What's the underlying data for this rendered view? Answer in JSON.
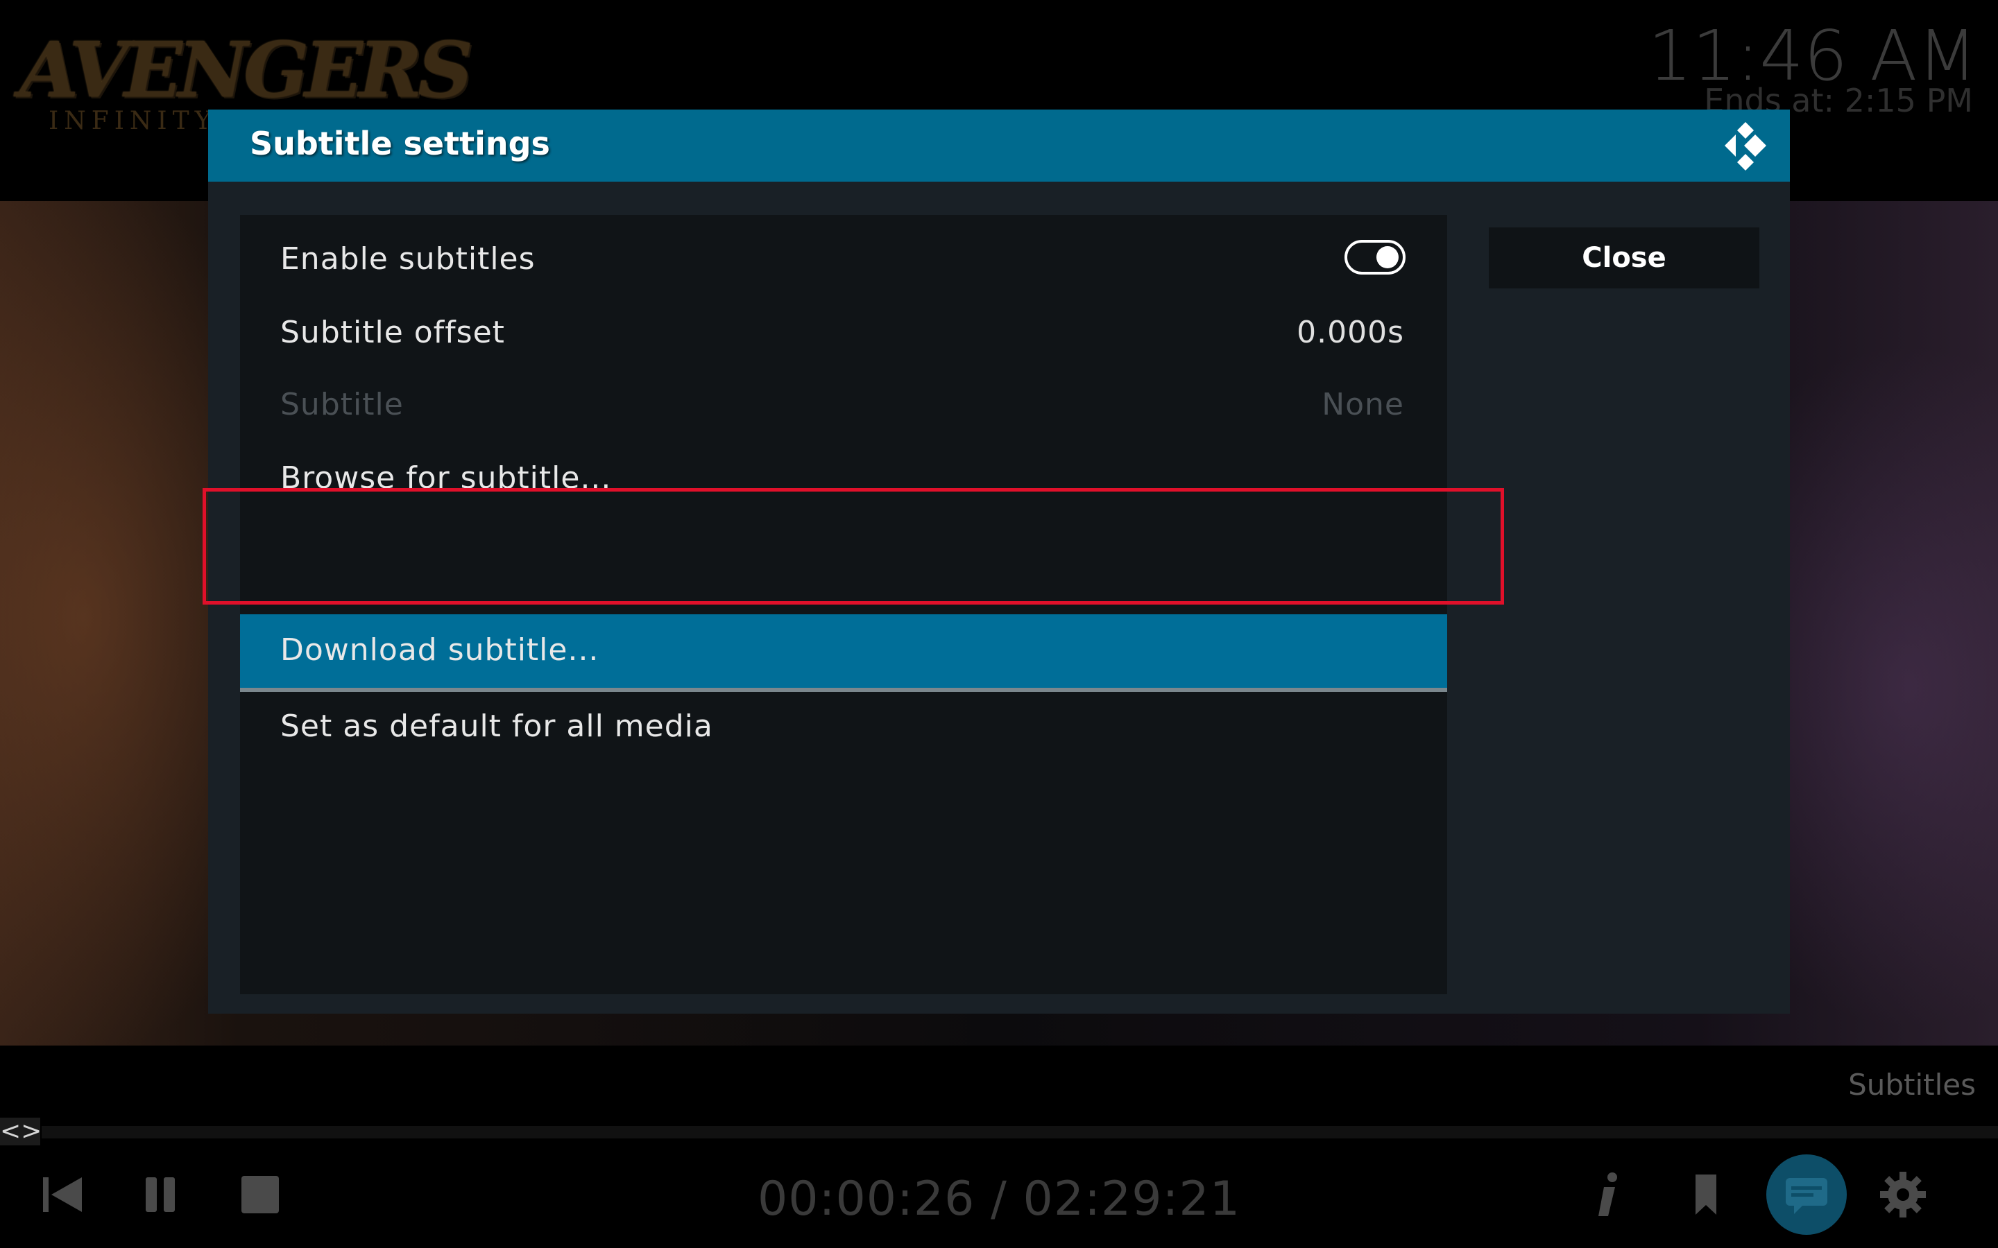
{
  "now_playing": {
    "logo_title": "AVENGERS",
    "logo_subtitle": "INFINITY"
  },
  "clock": {
    "time": "11:46 AM",
    "ends_at": "Ends at: 2:15 PM"
  },
  "dialog": {
    "title": "Subtitle settings",
    "close_label": "Close",
    "settings": [
      {
        "label": "Enable subtitles",
        "value": "",
        "control": "toggle",
        "toggle_on": true,
        "enabled": true,
        "focused": false
      },
      {
        "label": "Subtitle offset",
        "value": "0.000s",
        "enabled": true,
        "focused": false
      },
      {
        "label": "Subtitle",
        "value": "None",
        "enabled": false,
        "focused": false
      },
      {
        "label": "Browse for subtitle...",
        "value": "",
        "enabled": true,
        "focused": false
      },
      {
        "label": "Download subtitle...",
        "value": "",
        "enabled": true,
        "focused": true
      },
      {
        "label": "Set as default for all media",
        "value": "",
        "enabled": true,
        "focused": false
      }
    ]
  },
  "osd": {
    "section_label": "Subtitles",
    "seek_arrows": "<>",
    "time": "00:00:26 / 02:29:21",
    "buttons": [
      "previous-icon",
      "pause-icon",
      "stop-icon",
      "info-icon",
      "bookmark-icon",
      "subtitles-icon",
      "settings-gear-icon"
    ]
  },
  "colors": {
    "accent": "#006e98",
    "dialog_header": "#006a8e",
    "highlight": "#e0102a"
  }
}
